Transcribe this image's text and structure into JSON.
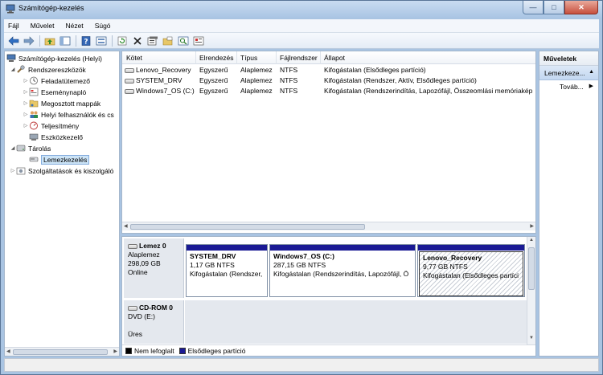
{
  "window": {
    "title": "Számítógép-kezelés",
    "controls": {
      "minimize": "—",
      "maximize": "□",
      "close": "✕"
    }
  },
  "menu": [
    "Fájl",
    "Művelet",
    "Nézet",
    "Súgó"
  ],
  "toolbar": {
    "buttons": [
      "back-icon",
      "forward-icon",
      "up-folder-icon",
      "show-hide-tree-icon",
      "help-icon",
      "properties-icon",
      "refresh-icon",
      "delete-icon",
      "properties-sheet-icon",
      "open-folder-icon",
      "search-icon",
      "settings-icon"
    ]
  },
  "tree": {
    "root": "Számítógép-kezelés (Helyi)",
    "system_tools": "Rendszereszközök",
    "task_scheduler": "Feladatütemező",
    "event_viewer": "Eseménynapló",
    "shared_folders": "Megosztott mappák",
    "local_users": "Helyi felhasználók és cs",
    "performance": "Teljesítmény",
    "device_manager": "Eszközkezelő",
    "storage": "Tárolás",
    "disk_management": "Lemezkezelés",
    "services": "Szolgáltatások és kiszolgáló"
  },
  "volumes": {
    "headers": {
      "volume": "Kötet",
      "layout": "Elrendezés",
      "type": "Típus",
      "fs": "Fájlrendszer",
      "status": "Állapot"
    },
    "rows": [
      {
        "volume": "Lenovo_Recovery",
        "layout": "Egyszerű",
        "type": "Alaplemez",
        "fs": "NTFS",
        "status": "Kifogástalan (Elsődleges partíció)"
      },
      {
        "volume": "SYSTEM_DRV",
        "layout": "Egyszerű",
        "type": "Alaplemez",
        "fs": "NTFS",
        "status": "Kifogástalan (Rendszer, Aktív, Elsődleges partíció)"
      },
      {
        "volume": "Windows7_OS (C:)",
        "layout": "Egyszerű",
        "type": "Alaplemez",
        "fs": "NTFS",
        "status": "Kifogástalan (Rendszerindítás, Lapozófájl, Összeomlási memóriakép"
      }
    ]
  },
  "disks": [
    {
      "name": "Lemez 0",
      "kind": "Alaplemez",
      "size": "298,09 GB",
      "state": "Online",
      "partitions": [
        {
          "name": "SYSTEM_DRV",
          "size": "1,17 GB NTFS",
          "status": "Kifogástalan (Rendszer,"
        },
        {
          "name": "Windows7_OS  (C:)",
          "size": "287,15 GB NTFS",
          "status": "Kifogástalan (Rendszerindítás, Lapozófájl, Ö"
        },
        {
          "name": "Lenovo_Recovery",
          "size": "9,77 GB NTFS",
          "status": "Kifogástalan (Elsődleges partíci"
        }
      ]
    },
    {
      "name": "CD-ROM 0",
      "kind": "DVD (E:)",
      "state": "Üres"
    }
  ],
  "legend": [
    {
      "label": "Nem lefoglalt",
      "color": "#000000"
    },
    {
      "label": "Elsődleges partíció",
      "color": "#1a1a94"
    }
  ],
  "actions": {
    "header": "Műveletek",
    "selected": "Lemezkeze...",
    "more": "Továb..."
  }
}
